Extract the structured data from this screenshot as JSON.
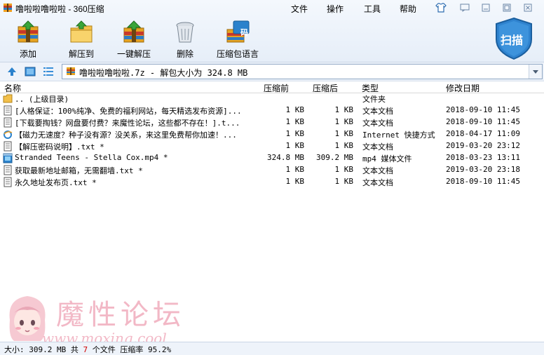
{
  "window": {
    "title": "噜啦啦噜啦啦 - 360压缩",
    "menu": [
      "文件",
      "操作",
      "工具",
      "帮助"
    ]
  },
  "toolbar": {
    "add": "添加",
    "extract_to": "解压到",
    "one_click_extract": "一键解压",
    "delete": "删除",
    "archive_language": "压缩包语言",
    "scan": "扫描",
    "lang_badge": "码"
  },
  "address": {
    "path": "噜啦啦噜啦啦.7z - 解包大小为 324.8 MB"
  },
  "columns": {
    "name": "名称",
    "size": "压缩前",
    "packed": "压缩后",
    "type": "类型",
    "modified": "修改日期"
  },
  "files": [
    {
      "icon": "folder-up-icon",
      "name": ".. (上级目录)",
      "size": "",
      "packed": "",
      "type": "文件夹",
      "modified": ""
    },
    {
      "icon": "text-file-icon",
      "name": "[人格保证：100%纯净、免费的福利网站，每天精选发布资源]...",
      "size": "1 KB",
      "packed": "1 KB",
      "type": "文本文档",
      "modified": "2018-09-10 11:45"
    },
    {
      "icon": "text-file-icon",
      "name": "[下载要掏钱？网盘要付费？来魔性论坛，这些都不存在！].t...",
      "size": "1 KB",
      "packed": "1 KB",
      "type": "文本文档",
      "modified": "2018-09-10 11:45"
    },
    {
      "icon": "internet-shortcut-icon",
      "name": "【磁力无速度？种子没有源？没关系，来这里免费帮你加速！...",
      "size": "1 KB",
      "packed": "1 KB",
      "type": "Internet 快捷方式",
      "modified": "2018-04-17 11:09"
    },
    {
      "icon": "text-file-icon",
      "name": "【解压密码说明】.txt *",
      "size": "1 KB",
      "packed": "1 KB",
      "type": "文本文档",
      "modified": "2019-03-20 23:12"
    },
    {
      "icon": "mp4-file-icon",
      "name": "Stranded Teens - Stella Cox.mp4 *",
      "size": "324.8 MB",
      "packed": "309.2 MB",
      "type": "mp4 媒体文件",
      "modified": "2018-03-23 13:11"
    },
    {
      "icon": "text-file-icon",
      "name": "获取最新地址邮箱，无需翻墙.txt *",
      "size": "1 KB",
      "packed": "1 KB",
      "type": "文本文档",
      "modified": "2019-03-20 23:18"
    },
    {
      "icon": "text-file-icon",
      "name": "永久地址发布页.txt *",
      "size": "1 KB",
      "packed": "1 KB",
      "type": "文本文档",
      "modified": "2018-09-10 11:45"
    }
  ],
  "watermark": {
    "title": "魔性论坛",
    "url": "www.moxing.cool"
  },
  "status": {
    "prefix": "大小: 309.2 MB 共 ",
    "count": "7",
    "suffix": " 个文件 压缩率 95.2%"
  }
}
